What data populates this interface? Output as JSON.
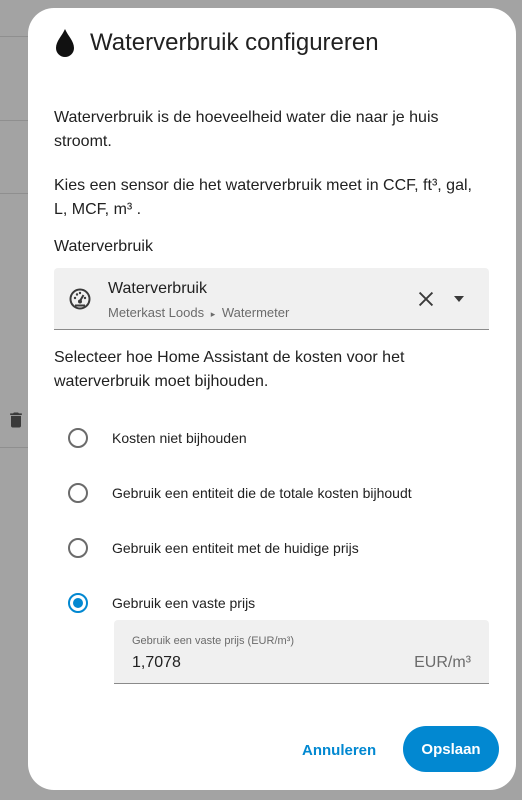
{
  "dialog": {
    "title": "Waterverbruik configureren",
    "intro": "Waterverbruik is de hoeveelheid water die naar je huis stroomt.",
    "sensor_hint": "Kies een sensor die het waterverbruik meet in CCF, ft³, gal, L, MCF, m³ .",
    "sensor_label": "Waterverbruik",
    "sensor": {
      "name": "Waterverbruik",
      "area": "Meterkast Loods",
      "device": "Watermeter",
      "separator": "▸"
    },
    "cost_hint": "Selecteer hoe Home Assistant de kosten voor het waterverbruik moet bijhouden.",
    "cost_options": [
      {
        "label": "Kosten niet bijhouden",
        "checked": false
      },
      {
        "label": "Gebruik een entiteit die de totale kosten bijhoudt",
        "checked": false
      },
      {
        "label": "Gebruik een entiteit met de huidige prijs",
        "checked": false
      },
      {
        "label": "Gebruik een vaste prijs",
        "checked": true
      }
    ],
    "fixed_price": {
      "label": "Gebruik een vaste prijs (EUR/m³)",
      "value": "1,7078",
      "suffix": "EUR/m³"
    },
    "buttons": {
      "cancel": "Annuleren",
      "save": "Opslaan"
    }
  },
  "colors": {
    "accent": "#0288d1",
    "backdrop": "#a3a3a3",
    "field_bg": "#f0f0f0"
  }
}
